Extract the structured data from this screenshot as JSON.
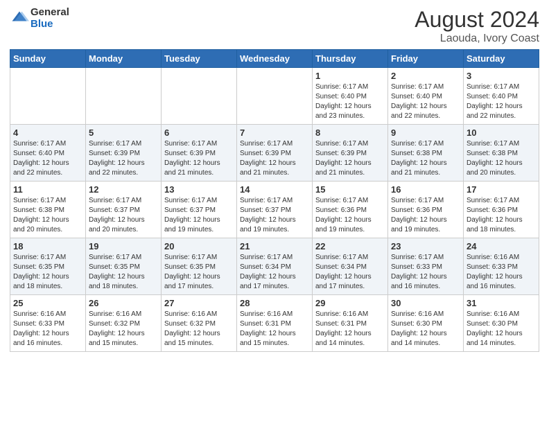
{
  "header": {
    "logo_general": "General",
    "logo_blue": "Blue",
    "month_year": "August 2024",
    "location": "Laouda, Ivory Coast"
  },
  "weekdays": [
    "Sunday",
    "Monday",
    "Tuesday",
    "Wednesday",
    "Thursday",
    "Friday",
    "Saturday"
  ],
  "weeks": [
    [
      {
        "day": "",
        "info": ""
      },
      {
        "day": "",
        "info": ""
      },
      {
        "day": "",
        "info": ""
      },
      {
        "day": "",
        "info": ""
      },
      {
        "day": "1",
        "info": "Sunrise: 6:17 AM\nSunset: 6:40 PM\nDaylight: 12 hours\nand 23 minutes."
      },
      {
        "day": "2",
        "info": "Sunrise: 6:17 AM\nSunset: 6:40 PM\nDaylight: 12 hours\nand 22 minutes."
      },
      {
        "day": "3",
        "info": "Sunrise: 6:17 AM\nSunset: 6:40 PM\nDaylight: 12 hours\nand 22 minutes."
      }
    ],
    [
      {
        "day": "4",
        "info": "Sunrise: 6:17 AM\nSunset: 6:40 PM\nDaylight: 12 hours\nand 22 minutes."
      },
      {
        "day": "5",
        "info": "Sunrise: 6:17 AM\nSunset: 6:39 PM\nDaylight: 12 hours\nand 22 minutes."
      },
      {
        "day": "6",
        "info": "Sunrise: 6:17 AM\nSunset: 6:39 PM\nDaylight: 12 hours\nand 21 minutes."
      },
      {
        "day": "7",
        "info": "Sunrise: 6:17 AM\nSunset: 6:39 PM\nDaylight: 12 hours\nand 21 minutes."
      },
      {
        "day": "8",
        "info": "Sunrise: 6:17 AM\nSunset: 6:39 PM\nDaylight: 12 hours\nand 21 minutes."
      },
      {
        "day": "9",
        "info": "Sunrise: 6:17 AM\nSunset: 6:38 PM\nDaylight: 12 hours\nand 21 minutes."
      },
      {
        "day": "10",
        "info": "Sunrise: 6:17 AM\nSunset: 6:38 PM\nDaylight: 12 hours\nand 20 minutes."
      }
    ],
    [
      {
        "day": "11",
        "info": "Sunrise: 6:17 AM\nSunset: 6:38 PM\nDaylight: 12 hours\nand 20 minutes."
      },
      {
        "day": "12",
        "info": "Sunrise: 6:17 AM\nSunset: 6:37 PM\nDaylight: 12 hours\nand 20 minutes."
      },
      {
        "day": "13",
        "info": "Sunrise: 6:17 AM\nSunset: 6:37 PM\nDaylight: 12 hours\nand 19 minutes."
      },
      {
        "day": "14",
        "info": "Sunrise: 6:17 AM\nSunset: 6:37 PM\nDaylight: 12 hours\nand 19 minutes."
      },
      {
        "day": "15",
        "info": "Sunrise: 6:17 AM\nSunset: 6:36 PM\nDaylight: 12 hours\nand 19 minutes."
      },
      {
        "day": "16",
        "info": "Sunrise: 6:17 AM\nSunset: 6:36 PM\nDaylight: 12 hours\nand 19 minutes."
      },
      {
        "day": "17",
        "info": "Sunrise: 6:17 AM\nSunset: 6:36 PM\nDaylight: 12 hours\nand 18 minutes."
      }
    ],
    [
      {
        "day": "18",
        "info": "Sunrise: 6:17 AM\nSunset: 6:35 PM\nDaylight: 12 hours\nand 18 minutes."
      },
      {
        "day": "19",
        "info": "Sunrise: 6:17 AM\nSunset: 6:35 PM\nDaylight: 12 hours\nand 18 minutes."
      },
      {
        "day": "20",
        "info": "Sunrise: 6:17 AM\nSunset: 6:35 PM\nDaylight: 12 hours\nand 17 minutes."
      },
      {
        "day": "21",
        "info": "Sunrise: 6:17 AM\nSunset: 6:34 PM\nDaylight: 12 hours\nand 17 minutes."
      },
      {
        "day": "22",
        "info": "Sunrise: 6:17 AM\nSunset: 6:34 PM\nDaylight: 12 hours\nand 17 minutes."
      },
      {
        "day": "23",
        "info": "Sunrise: 6:17 AM\nSunset: 6:33 PM\nDaylight: 12 hours\nand 16 minutes."
      },
      {
        "day": "24",
        "info": "Sunrise: 6:16 AM\nSunset: 6:33 PM\nDaylight: 12 hours\nand 16 minutes."
      }
    ],
    [
      {
        "day": "25",
        "info": "Sunrise: 6:16 AM\nSunset: 6:33 PM\nDaylight: 12 hours\nand 16 minutes."
      },
      {
        "day": "26",
        "info": "Sunrise: 6:16 AM\nSunset: 6:32 PM\nDaylight: 12 hours\nand 15 minutes."
      },
      {
        "day": "27",
        "info": "Sunrise: 6:16 AM\nSunset: 6:32 PM\nDaylight: 12 hours\nand 15 minutes."
      },
      {
        "day": "28",
        "info": "Sunrise: 6:16 AM\nSunset: 6:31 PM\nDaylight: 12 hours\nand 15 minutes."
      },
      {
        "day": "29",
        "info": "Sunrise: 6:16 AM\nSunset: 6:31 PM\nDaylight: 12 hours\nand 14 minutes."
      },
      {
        "day": "30",
        "info": "Sunrise: 6:16 AM\nSunset: 6:30 PM\nDaylight: 12 hours\nand 14 minutes."
      },
      {
        "day": "31",
        "info": "Sunrise: 6:16 AM\nSunset: 6:30 PM\nDaylight: 12 hours\nand 14 minutes."
      }
    ]
  ]
}
